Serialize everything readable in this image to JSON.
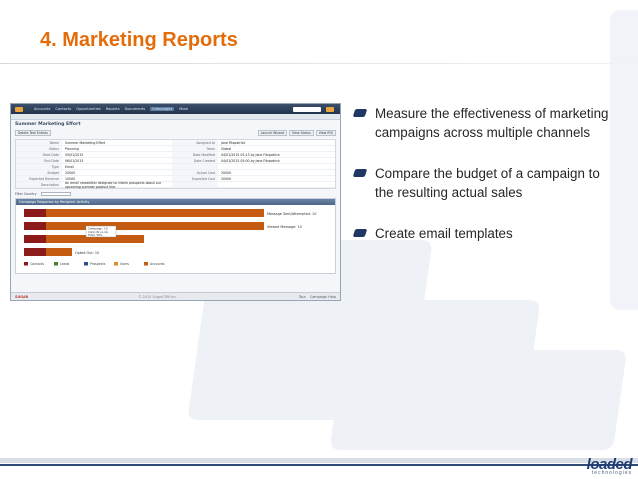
{
  "slide": {
    "title": "4. Marketing Reports",
    "bullets": [
      "Measure the effectiveness of marketing campaigns across multiple channels",
      "Compare the budget of a campaign to the resulting actual sales",
      "Create email templates"
    ],
    "logo": {
      "word": "loaded",
      "sub": "technologies"
    }
  },
  "colors": {
    "title": "#e46c0a",
    "bullet_marker": "#1f3864",
    "chart_bar": "#c55a11",
    "chart_bar_dark": "#8b1a1a"
  },
  "screenshot": {
    "nav": [
      "Accounts",
      "Contacts",
      "Opportunities",
      "Reports",
      "Documents",
      "Campaigns",
      "More"
    ],
    "active_tab": "Campaigns",
    "record_title": "Summer Marketing Effort",
    "buttons_left": [
      "Delete Test Entries"
    ],
    "buttons_right": [
      "Launch Wizard",
      "View Status",
      "View ROI"
    ],
    "fields": [
      {
        "l": "Name",
        "v": "Summer Marketing Effort",
        "l2": "Assigned to",
        "v2": "Jane Fitzpatrick"
      },
      {
        "l": "Status",
        "v": "Planning",
        "l2": "Team",
        "v2": "Global"
      },
      {
        "l": "Start Date",
        "v": "05/01/2015",
        "l2": "Date Modified",
        "v2": "04/01/2015 03:13 by Jane Fitzpatrick"
      },
      {
        "l": "End Date",
        "v": "06/01/2015",
        "l2": "Date Created",
        "v2": "04/01/2015 05:00 by Jane Fitzpatrick"
      },
      {
        "l": "Type",
        "v": "Email",
        "l2": "",
        "v2": ""
      },
      {
        "l": "Budget",
        "v": "20000",
        "l2": "Actual Cost",
        "v2": "20000"
      },
      {
        "l": "Expected Revenue",
        "v": "10000",
        "l2": "Expected Cost",
        "v2": "20000"
      },
      {
        "l": "Description",
        "v": "An email newsletter designed to inform prospects about our upcoming summer product line.",
        "l2": "",
        "v2": ""
      }
    ],
    "filter_label": "Filter Country",
    "chart_title": "Campaign Response by Recipient Activity",
    "footer_brand": "SUGAR",
    "footer_copy": "© 2015 SugarCRM Inc.",
    "footer_tools": [
      "Tour",
      "Campaign Help"
    ]
  },
  "chart_data": {
    "type": "bar",
    "orientation": "horizontal",
    "title": "Campaign Response by Recipient Activity",
    "categories": [
      "Message Sent/Attempted",
      "Viewed Message",
      "Click-thru Link",
      "Opted Out"
    ],
    "data_labels": [
      "Message Sent/Attempted: 10",
      "Viewed Message: 10",
      "",
      "Opted Out: 10"
    ],
    "values": [
      10,
      10,
      5,
      2
    ],
    "legend": [
      "Contacts",
      "Leads",
      "Prospects",
      "Users",
      "Accounts"
    ],
    "legend_colors": [
      "#8b1a1a",
      "#4f7e2f",
      "#2f4f8f",
      "#e08a2c",
      "#c55a11"
    ],
    "tooltip": [
      "Campaign: 10",
      "Click-thru Link",
      "Total: 50%"
    ]
  }
}
